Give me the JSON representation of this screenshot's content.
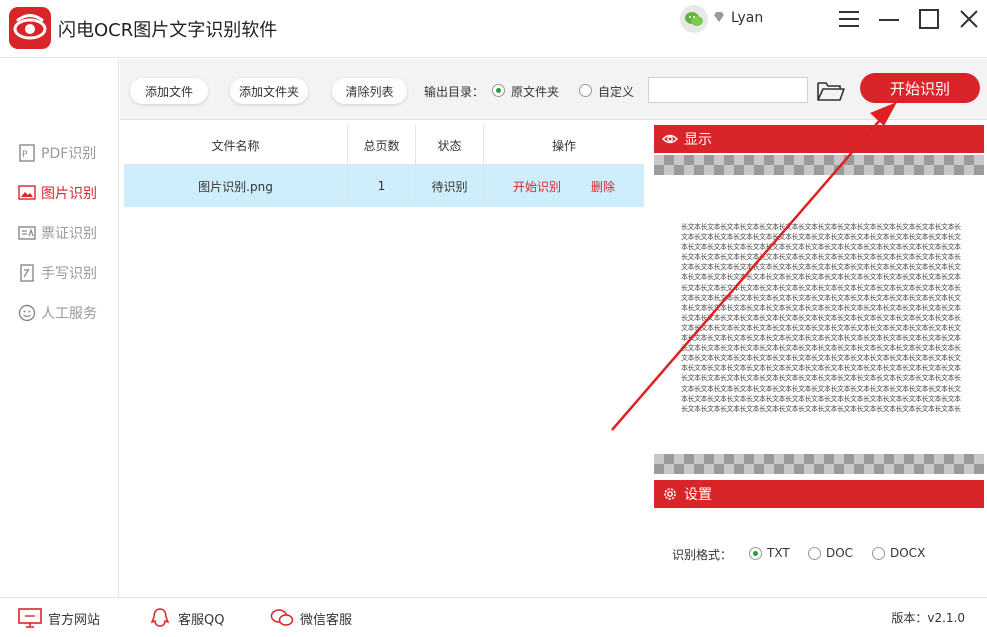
{
  "app": {
    "title": "闪电OCR图片文字识别软件",
    "username": "Lyan"
  },
  "sidebar": {
    "items": [
      {
        "label": "PDF识别",
        "icon": "pdf-icon"
      },
      {
        "label": "图片识别",
        "icon": "image-icon",
        "active": true
      },
      {
        "label": "票证识别",
        "icon": "id-card-icon"
      },
      {
        "label": "手写识别",
        "icon": "handwriting-icon"
      },
      {
        "label": "人工服务",
        "icon": "smile-icon"
      }
    ]
  },
  "toolbar": {
    "add_file": "添加文件",
    "add_folder": "添加文件夹",
    "clear_list": "清除列表",
    "output_label": "输出目录：",
    "option_original": "原文件夹",
    "option_custom": "自定义",
    "path_value": "",
    "start": "开始识别"
  },
  "table": {
    "headers": [
      "文件名称",
      "总页数",
      "状态",
      "操作"
    ],
    "rows": [
      {
        "name": "图片识别.png",
        "pages": "1",
        "status": "待识别",
        "action_start": "开始识别",
        "action_delete": "删除"
      }
    ]
  },
  "preview": {
    "title": "显示",
    "text": "长文本长文本长文本长文本长文本长文本长文本长文本长文本长文本长文本长文本长文本长文本长文本长文本长文本长文本长文本长文本长文本长文本长文本长文本长文本长文本长文本长文本长文本长文本长文本长文本长文本长文本长文本长文本长文本长文本长文本长文本长文本长文本长文本长文本长文本长文本长文本长文本长文本长文本长文本长文本长文本长文本长文本长文本长文本长文本长文本长文本长文本长文本长文本长文本长文本长文本长文本长文本长文本长文本长文本长文本长文本长文本长文本长文本长文本长文本长文本长文本长文本长文本长文本长文本长文本长文本长文本长文本长文本长文本长文本长文本长文本长文本长文本长文本长文本长文本长文本长文本长文本长文本长文本长文本长文本长文本长文本长文本长文本长文本长文本长文本长文本长文本长文本长文本长文本长文本长文本长文本长文本长文本长文本长文本长文本长文本长文本长文本长文本长文本长文本长文本长文本长文本长文本长文本长文本长文本长文本长文本长文本长文本长文本长文本长文本长文本长文本长文本长文本长文本长文本长文本长文本长文本长文本长文本长文本长文本长文本长文本长文本长文本长文本长文本长文本长文本长文本长文本长文本长文本长文本长文本长文本长文本长文本长文本长文本长文本长文本长文本长文本长文本长文本长文本长文本长文本长文本长文本长文本长文本长文本长文本长文本长文本长文本长文本长文本长文本长文本长文本长文本长文本长文本长文本长文本长文本长文本长文本长文本长文本长文本长文本长文本长文本长文本长文本长文本长文本长文本长文本长文本长文本长文本长文本长文本长文本长文本长文本长文本长文本长文本长文本长文本长文本长文本长文本长文本长文本长文本长文本长文本长文本长文本长文本长文本长文本长文本长文本长文本长文本长文本长文本长文本长文本长文本长文本长文本长文本长文本长文本长文本长文本长文本长文本长文本长文本长文本长文本长文本长文本长文本长文本长文本长文本长文本长文本长文本长文本长文本"
  },
  "settings": {
    "title": "设置",
    "format_label": "识别格式：",
    "formats": [
      "TXT",
      "DOC",
      "DOCX"
    ],
    "selected": "TXT"
  },
  "footer": {
    "website": "官方网站",
    "qq": "客服QQ",
    "wechat": "微信客服",
    "version": "版本：v2.1.0"
  },
  "colors": {
    "accent": "#d9252a",
    "selected_row": "#cfeefc",
    "radio_on": "#2a9d3a"
  }
}
